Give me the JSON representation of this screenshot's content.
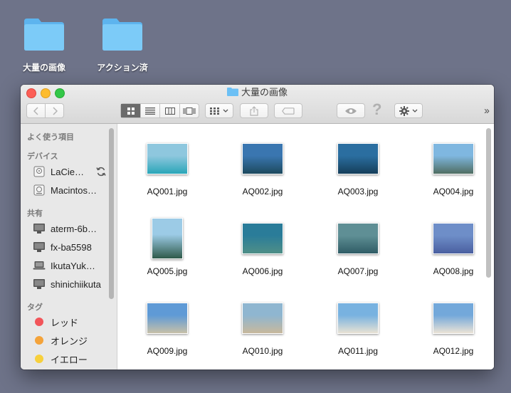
{
  "desktop": {
    "items": [
      {
        "label": "大量の画像"
      },
      {
        "label": "アクション済"
      }
    ]
  },
  "window": {
    "title": "大量の画像",
    "toolbar": {
      "back_icon": "chevron-left-icon",
      "forward_icon": "chevron-right-icon",
      "view_icons": [
        "icon-view-icon",
        "list-view-icon",
        "column-view-icon",
        "coverflow-view-icon"
      ],
      "active_view": 0,
      "arrange_icon": "grid-arrange-icon",
      "share_icon": "share-icon",
      "tag_icon": "tag-icon",
      "quicklook_icon": "eye-icon",
      "help_label": "?",
      "action_icon": "gear-icon",
      "more_label": "››"
    }
  },
  "sidebar": {
    "sections": [
      {
        "title": "よく使う項目",
        "items": []
      },
      {
        "title": "デバイス",
        "items": [
          {
            "label": "LaCie…",
            "icon": "external-disk-icon",
            "trailing_icon": "sync-icon"
          },
          {
            "label": "Macintos…",
            "icon": "hard-disk-icon"
          }
        ]
      },
      {
        "title": "共有",
        "items": [
          {
            "label": "aterm-6b…",
            "icon": "monitor-icon"
          },
          {
            "label": "fx-ba5598",
            "icon": "monitor-icon"
          },
          {
            "label": "IkutaYuk…",
            "icon": "laptop-icon"
          },
          {
            "label": "shinichiikuta",
            "icon": "monitor-icon"
          }
        ]
      },
      {
        "title": "タグ",
        "items": [
          {
            "label": "レッド",
            "color": "#f2555a"
          },
          {
            "label": "オレンジ",
            "color": "#f4a33a"
          },
          {
            "label": "イエロー",
            "color": "#f7d03c"
          }
        ]
      }
    ]
  },
  "files": [
    {
      "name": "AQ001.jpg",
      "orientation": "landscape",
      "top": "#8ec7de",
      "bottom": "#2aa6b8"
    },
    {
      "name": "AQ002.jpg",
      "orientation": "landscape",
      "top": "#3a76b0",
      "bottom": "#1d4a5e"
    },
    {
      "name": "AQ003.jpg",
      "orientation": "landscape",
      "top": "#2b6ea0",
      "bottom": "#153e5a"
    },
    {
      "name": "AQ004.jpg",
      "orientation": "landscape",
      "top": "#7fb7e0",
      "bottom": "#4f6d62"
    },
    {
      "name": "AQ005.jpg",
      "orientation": "portrait",
      "top": "#9ccbe6",
      "bottom": "#2f5a4a"
    },
    {
      "name": "AQ006.jpg",
      "orientation": "landscape",
      "top": "#2a7c99",
      "bottom": "#4f8f87"
    },
    {
      "name": "AQ007.jpg",
      "orientation": "landscape",
      "top": "#5f8f95",
      "bottom": "#2f5c65"
    },
    {
      "name": "AQ008.jpg",
      "orientation": "landscape",
      "top": "#6e8ec8",
      "bottom": "#4a5fa0"
    },
    {
      "name": "AQ009.jpg",
      "orientation": "landscape",
      "top": "#5f9ad6",
      "bottom": "#c7c0a8"
    },
    {
      "name": "AQ010.jpg",
      "orientation": "landscape",
      "top": "#8fb6d0",
      "bottom": "#c8b89c"
    },
    {
      "name": "AQ011.jpg",
      "orientation": "landscape",
      "top": "#78b2e0",
      "bottom": "#e8e2d4"
    },
    {
      "name": "AQ012.jpg",
      "orientation": "landscape",
      "top": "#73a8da",
      "bottom": "#ebe3d6"
    }
  ],
  "colors": {
    "accent_folder": "#6cc0f5",
    "desktop_bg": "#6e7389"
  }
}
